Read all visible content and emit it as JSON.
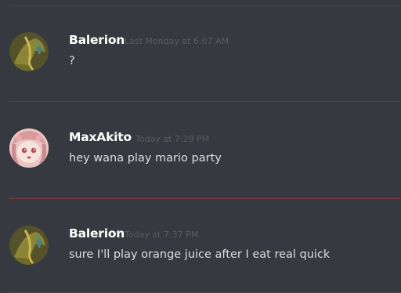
{
  "messages": [
    {
      "username": "Balerion",
      "timestamp": "Last Monday at 6:07 AM",
      "content": "?",
      "avatar": "balerion-avatar"
    },
    {
      "username": "MaxAkito",
      "timestamp": "Today at 7:29 PM",
      "content": "hey wana play mario party",
      "avatar": "maxakito-avatar"
    },
    {
      "username": "Balerion",
      "timestamp": "Today at 7:37 PM",
      "content": "sure I'll play orange juice after I eat real quick",
      "avatar": "balerion-avatar"
    }
  ],
  "colors": {
    "background": "#36393f",
    "username": "#ffffff",
    "timestamp": "#585c63",
    "content": "#dcddde",
    "new_message_divider": "#7b3a3c"
  }
}
